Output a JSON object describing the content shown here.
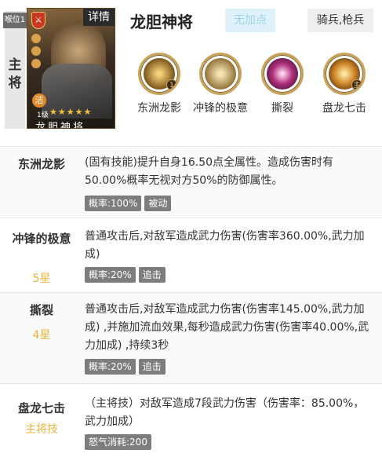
{
  "header": {
    "slot_label": "喉位1",
    "role": "主将",
    "detail_button": "详情",
    "hero_name": "龙胆神将",
    "bonus_status": "无加点",
    "troop_type": "骑兵,枪兵",
    "portrait": {
      "tag": "洁",
      "level": "1级",
      "stars": "★★★★★",
      "name": "龙胆神将"
    }
  },
  "skill_icons": [
    {
      "label": "东洲龙影",
      "icon": "dragon-shadow-icon",
      "num": "1"
    },
    {
      "label": "冲锋的极意",
      "icon": "cavalry-charge-icon",
      "num": ""
    },
    {
      "label": "撕裂",
      "icon": "tear-claw-icon",
      "num": ""
    },
    {
      "label": "盘龙七击",
      "icon": "dragon-strike-icon",
      "num": "主"
    }
  ],
  "skills": [
    {
      "name": "东洲龙影",
      "tier": "",
      "desc": "(固有技能)提升自身16.50点全属性。造成伤害时有50.00%概率无视对方50%的防御属性。",
      "tags": [
        "概率:100%",
        "被动"
      ]
    },
    {
      "name": "冲锋的极意",
      "tier": "5星",
      "desc": "普通攻击后,对敌军造成武力伤害(伤害率360.00%,武力加成)",
      "tags": [
        "概率:20%",
        "追击"
      ]
    },
    {
      "name": "撕裂",
      "tier": "4星",
      "desc": "普通攻击后,对敌军造成武力伤害(伤害率145.00%,武力加成) ,并施加流血效果,每秒造成武力伤害(伤害率40.00%,武力加成) ,持续3秒",
      "tags": [
        "概率:20%",
        "追击"
      ]
    },
    {
      "name": "盘龙七击",
      "tier": "主将技",
      "desc": "（主将技）对敌军造成7段武力伤害（伤害率：85.00%，武力加成）",
      "tags": [
        "怒气消耗:200"
      ]
    }
  ],
  "colors": {
    "tier_gold": "#e8b53b",
    "tag_gray": "#7d7d7d",
    "no_bonus_bg": "#dff2fb",
    "no_bonus_text": "#9ad1ec"
  }
}
